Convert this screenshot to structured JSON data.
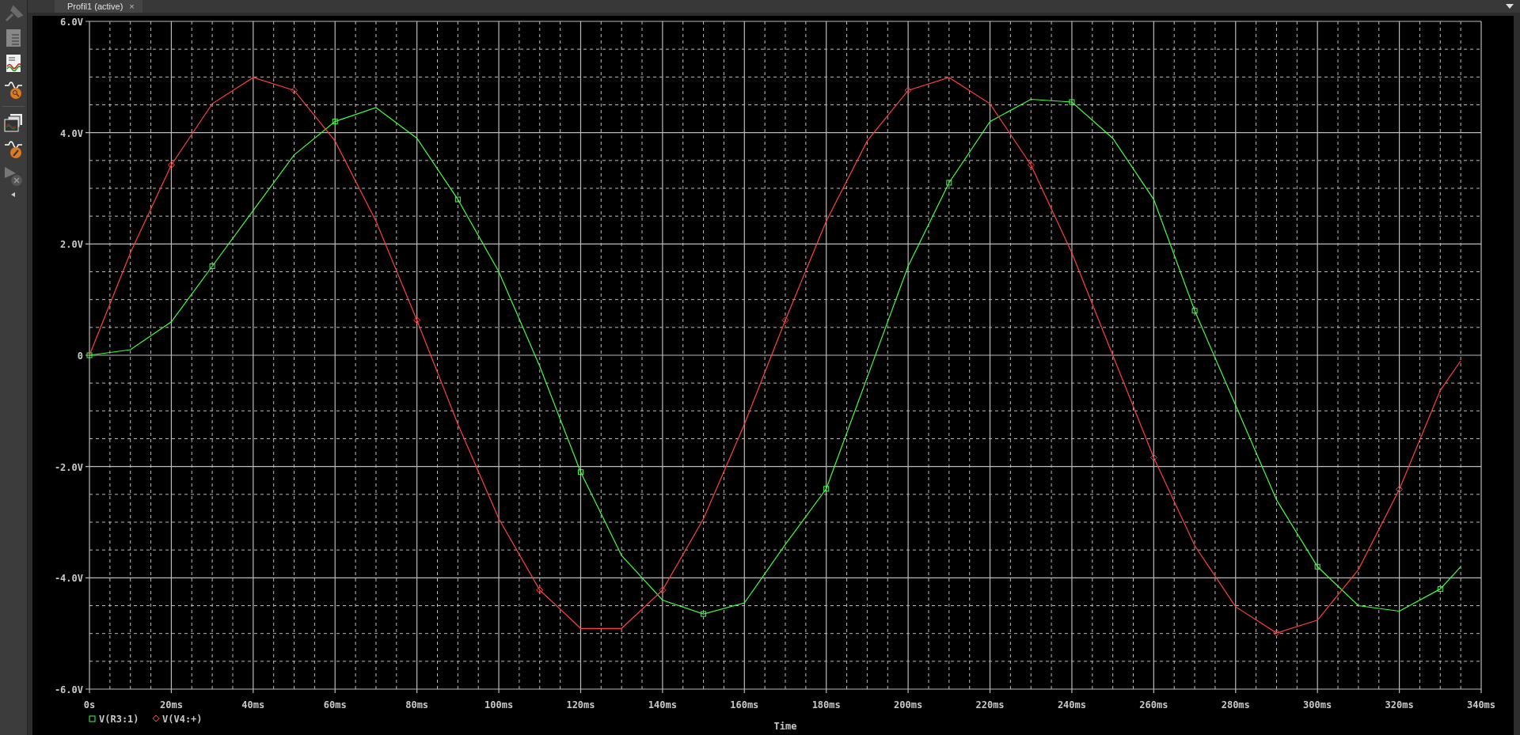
{
  "tab": {
    "label": "Profil1 (active)",
    "close": "×",
    "selected": true
  },
  "plot": {
    "chart_data": {
      "type": "line",
      "xlabel": "Time",
      "x": [
        0,
        10,
        20,
        30,
        40,
        50,
        60,
        70,
        80,
        90,
        100,
        110,
        120,
        130,
        140,
        150,
        160,
        170,
        180,
        190,
        200,
        210,
        220,
        230,
        240,
        250,
        260,
        270,
        280,
        290,
        300,
        310,
        320,
        330,
        335
      ],
      "series": [
        {
          "name": "V(R3:1)",
          "color": "#40ff40",
          "values": [
            0,
            0.1,
            0.6,
            1.6,
            2.6,
            3.6,
            4.2,
            4.45,
            3.9,
            2.8,
            1.5,
            -0.2,
            -2.1,
            -3.6,
            -4.4,
            -4.65,
            -4.45,
            -3.4,
            -2.4,
            -0.4,
            1.6,
            3.1,
            4.2,
            4.6,
            4.55,
            3.9,
            2.8,
            0.8,
            -0.9,
            -2.6,
            -3.8,
            -4.5,
            -4.6,
            -4.2,
            -3.8
          ]
        },
        {
          "name": "V(V4:+)",
          "color": "#ff4040",
          "values": [
            0,
            1.84,
            3.42,
            4.52,
            4.99,
            4.76,
            3.85,
            2.41,
            0.63,
            -1.24,
            -2.94,
            -4.22,
            -4.91,
            -4.91,
            -4.22,
            -2.94,
            -1.24,
            0.63,
            2.41,
            3.85,
            4.76,
            4.99,
            4.52,
            3.42,
            1.84,
            0,
            -1.84,
            -3.42,
            -4.52,
            -4.99,
            -4.76,
            -3.85,
            -2.41,
            -0.63,
            -0.1
          ]
        }
      ],
      "xlim": [
        0,
        340
      ],
      "ylim": [
        -6,
        6
      ],
      "grid": true,
      "legend": true,
      "xticks": [
        {
          "value": 0,
          "label": "0s"
        },
        {
          "value": 20,
          "label": "20ms"
        },
        {
          "value": 40,
          "label": "40ms"
        },
        {
          "value": 60,
          "label": "60ms"
        },
        {
          "value": 80,
          "label": "80ms"
        },
        {
          "value": 100,
          "label": "100ms"
        },
        {
          "value": 120,
          "label": "120ms"
        },
        {
          "value": 140,
          "label": "140ms"
        },
        {
          "value": 160,
          "label": "160ms"
        },
        {
          "value": 180,
          "label": "180ms"
        },
        {
          "value": 200,
          "label": "200ms"
        },
        {
          "value": 220,
          "label": "220ms"
        },
        {
          "value": 240,
          "label": "240ms"
        },
        {
          "value": 260,
          "label": "260ms"
        },
        {
          "value": 280,
          "label": "280ms"
        },
        {
          "value": 300,
          "label": "300ms"
        },
        {
          "value": 320,
          "label": "320ms"
        },
        {
          "value": 340,
          "label": "340ms"
        }
      ],
      "yticks": [
        {
          "value": 6,
          "label": "6.0V"
        },
        {
          "value": 4,
          "label": "4.0V"
        },
        {
          "value": 2,
          "label": "2.0V"
        },
        {
          "value": 0,
          "label": "0"
        },
        {
          "value": -2,
          "label": "-2.0V"
        },
        {
          "value": -4,
          "label": "-4.0V"
        },
        {
          "value": -6,
          "label": "-6.0V"
        }
      ]
    }
  }
}
